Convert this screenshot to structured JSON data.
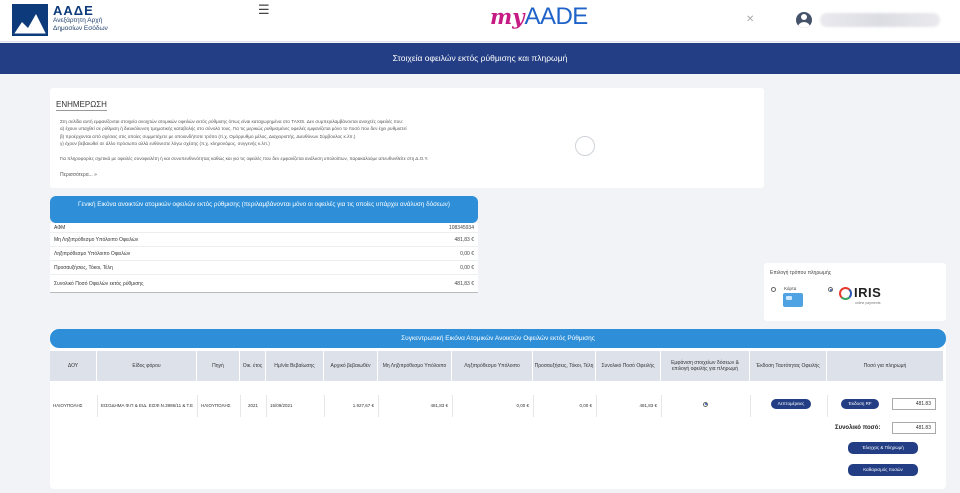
{
  "header": {
    "org_title": "ΑΑΔΕ",
    "org_line1": "Ανεξάρτητη Αρχή",
    "org_line2": "Δημοσίων Εσόδων",
    "brand_prefix": "my",
    "brand_name": "AADE",
    "close_glyph": "✕"
  },
  "page_title": "Στοιχεία οφειλών εκτός ρύθμισης και πληρωμή",
  "info": {
    "heading": "ΕΝΗΜΕΡΩΣΗ",
    "text1": "Στη σελίδα αυτή εμφανίζονται στοιχεία ανοιχτών ατομικών οφειλών εκτός ρύθμισης όπως είναι καταχωρημένα στο TAXIS. Δεν συμπεριλαμβάνονται ανοιχτές οφειλές που:",
    "text2": "α) έχουν υπαχθεί σε ρύθμιση ή διευκόλυνση τμηματικής καταβολής στο σύνολό τους. Για τις μερικώς ρυθμισμένες οφειλές εμφανίζεται μόνο το ποσό που δεν έχει ρυθμιστεί",
    "text3": "β) προέρχονται από σχέσεις στις οποίες συμμετέχετε με οποιονδήποτε τρόπο (π.χ. Ομόρρυθμο μέλος, Διαχειριστής, Διευθύνων Σύμβουλος κ.λπ.)",
    "text4": "γ) έχουν βεβαιωθεί σε άλλο πρόσωπο αλλά ευθύνεστε λόγω σχέσης (π.χ. κληρονόμος, συγγενής κ.λπ.)",
    "text5": "Για πληροφορίες σχετικά με οφειλές συνοφειλέτη ή και συνυπευθυνότητας καθώς και για τις οφειλές που δεν εμφανίζεται ανάλυση υπολοίπων, παρακαλούμε απευθυνθείτε στη Δ.Ο.Υ.",
    "more": "Περισσότερα... »"
  },
  "summary": {
    "title": "Γενική Εικόνα ανοικτών ατομικών οφειλών εκτός ρύθμισης (περιλαμβάνονται μόνο οι οφειλές για τις οποίες υπάρχει ανάλυση δόσεων)",
    "rows": [
      {
        "label": "ΑΦΜ",
        "value": "108345934"
      },
      {
        "label": "Μη Ληξιπρόθεσμο Υπόλοιπο Οφειλών",
        "value": "481,83 €"
      },
      {
        "label": "Ληξιπρόθεσμο Υπόλοιπο Οφειλών",
        "value": "0,00 €"
      },
      {
        "label": "Προσαυξήσεις, Τόκοι, Τέλη",
        "value": "0,00 €"
      },
      {
        "label": "Συνολικό Ποσό Οφειλών εκτός ρύθμισης",
        "value": "481,83 €"
      }
    ]
  },
  "payment_method": {
    "label": "Επιλογή τρόπου πληρωμής",
    "card_label": "Κάρτα",
    "iris_label": "IRIS",
    "iris_sub": "online payments"
  },
  "detail": {
    "title": "Συγκεντρωτική Εικόνα Ατομικών Ανοικτών Οφειλών εκτός Ρύθμισης",
    "columns": [
      "ΔΟΥ",
      "Είδος φόρου",
      "Πηγή",
      "Οικ. έτος",
      "Ημ/νία Βεβαίωσης",
      "Αρχικό βεβαιωθέν",
      "Μη Ληξιπρόθεσμο Υπόλοιπο",
      "Ληξιπρόθεσμο Υπόλοιπο",
      "Προσαυξήσεις, Τόκοι, Τέλη",
      "Συνολικό Ποσό Οφειλής",
      "Εμφάνιση στοιχείων δόσεων & επιλογή οφειλής για πληρωμή",
      "Έκδοση Ταυτότητας Οφειλής",
      "Ποσό για πληρωμή"
    ],
    "row": {
      "doy": "ΗΛΙΟΥΠΟΛΗΣ",
      "tax_type": "ΕΙΣΟΔΗΜΑ Φ.Π & ΕΙΔ. ΕΙΣΦ.Ν.3986/11 & Τ.Ε",
      "source": "ΗΛΙΟΥΠΟΛΗΣ",
      "year": "2021",
      "date": "15/09/2021",
      "initial": "1.927,67 €",
      "not_overdue": "481,83 €",
      "overdue": "0,00 €",
      "surcharges": "0,00 €",
      "total": "481,83 €",
      "details_btn": "Λεπτομέρειες",
      "issue_btn": "Έκδοση RF",
      "amount": "481.83"
    },
    "total_label": "Συνολικό ποσό:",
    "total_value": "481.83",
    "check_pay_btn": "Έλεγχος & Πληρωμή",
    "clear_btn": "Καθαρισμός ποσών"
  }
}
